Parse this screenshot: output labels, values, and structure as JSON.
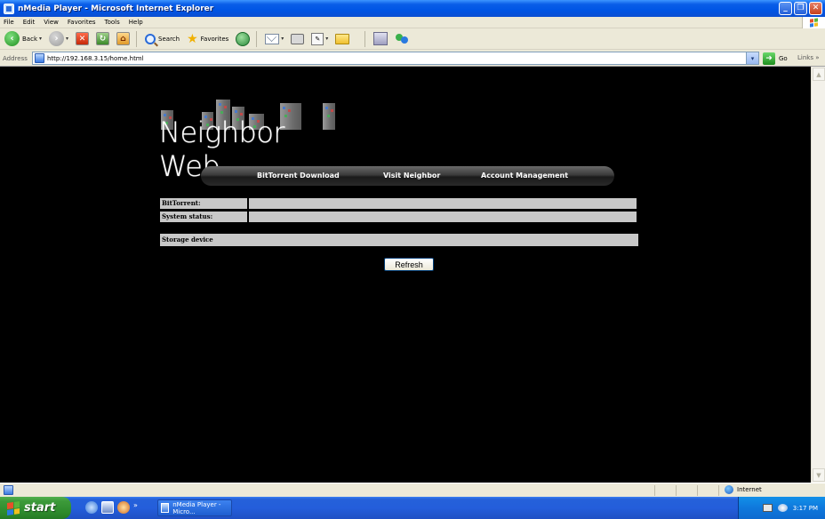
{
  "window": {
    "title": "nMedia Player - Microsoft Internet Explorer"
  },
  "menu": {
    "items": [
      "File",
      "Edit",
      "View",
      "Favorites",
      "Tools",
      "Help"
    ]
  },
  "toolbar": {
    "back_label": "Back",
    "search_label": "Search",
    "favorites_label": "Favorites"
  },
  "address": {
    "label": "Address",
    "url": "http://192.168.3.15/home.html",
    "go_label": "Go",
    "links_label": "Links"
  },
  "page": {
    "logo_text": "Neighbor Web",
    "nav": [
      "BitTorrent Download",
      "Visit Neighbor",
      "Account Management"
    ],
    "rows": [
      {
        "label": "BitTorrent:",
        "value": ""
      },
      {
        "label": "System status:",
        "value": ""
      }
    ],
    "storage_label": "Storage device",
    "refresh_label": "Refresh"
  },
  "status": {
    "zone": "Internet"
  },
  "taskbar": {
    "start_label": "start",
    "task_title": "nMedia Player - Micro...",
    "clock": "3:17 PM"
  },
  "colors": {
    "titlebar": "#0055e5",
    "page_bg": "#000000",
    "row_bg": "#c8c8c8",
    "taskbar": "#245edb",
    "start": "#3c9a3a"
  }
}
